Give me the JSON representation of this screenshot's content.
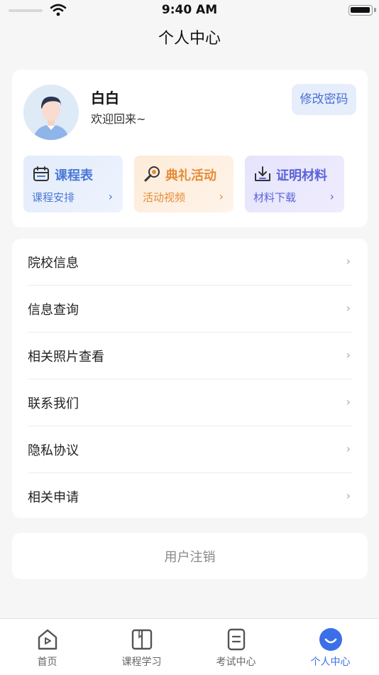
{
  "status_bar": {
    "time": "9:40 AM"
  },
  "nav": {
    "title": "个人中心"
  },
  "profile": {
    "name": "白白",
    "welcome": "欢迎回来~",
    "change_password": "修改密码"
  },
  "shortcuts": [
    {
      "title": "课程表",
      "subtitle": "课程安排",
      "icon": "calendar-icon",
      "color": "#4a78d6"
    },
    {
      "title": "典礼活动",
      "subtitle": "活动视频",
      "icon": "microphone-icon",
      "color": "#e58d38"
    },
    {
      "title": "证明材料",
      "subtitle": "材料下载",
      "icon": "download-icon",
      "color": "#5c63d8"
    }
  ],
  "menu": [
    {
      "label": "院校信息"
    },
    {
      "label": "信息查询"
    },
    {
      "label": "相关照片查看"
    },
    {
      "label": "联系我们"
    },
    {
      "label": "隐私协议"
    },
    {
      "label": "相关申请"
    }
  ],
  "logout": {
    "label": "用户注销"
  },
  "tabs": [
    {
      "label": "首页",
      "icon": "home-icon",
      "active": false
    },
    {
      "label": "课程学习",
      "icon": "book-icon",
      "active": false
    },
    {
      "label": "考试中心",
      "icon": "exam-icon",
      "active": false
    },
    {
      "label": "个人中心",
      "icon": "profile-icon",
      "active": true
    }
  ],
  "colors": {
    "accent": "#3b6fe8",
    "background": "#f6f6f7"
  }
}
